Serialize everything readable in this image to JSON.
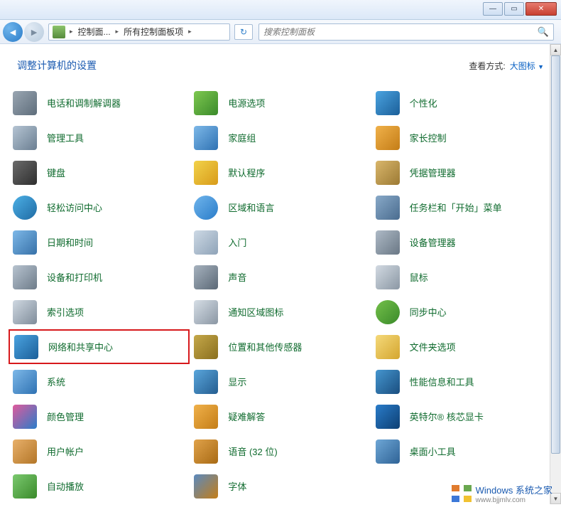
{
  "breadcrumb": {
    "seg1": "控制面...",
    "seg2": "所有控制面板项"
  },
  "search": {
    "placeholder": "搜索控制面板"
  },
  "header": {
    "title": "调整计算机的设置",
    "view_label": "查看方式:",
    "view_value": "大图标"
  },
  "items": [
    {
      "label": "电话和调制解调器",
      "icon": "ic-phone"
    },
    {
      "label": "电源选项",
      "icon": "ic-power"
    },
    {
      "label": "个性化",
      "icon": "ic-personalize"
    },
    {
      "label": "管理工具",
      "icon": "ic-admin"
    },
    {
      "label": "家庭组",
      "icon": "ic-home"
    },
    {
      "label": "家长控制",
      "icon": "ic-parental"
    },
    {
      "label": "键盘",
      "icon": "ic-keyboard"
    },
    {
      "label": "默认程序",
      "icon": "ic-default"
    },
    {
      "label": "凭据管理器",
      "icon": "ic-cred"
    },
    {
      "label": "轻松访问中心",
      "icon": "ic-ease"
    },
    {
      "label": "区域和语言",
      "icon": "ic-region"
    },
    {
      "label": "任务栏和「开始」菜单",
      "icon": "ic-taskbar"
    },
    {
      "label": "日期和时间",
      "icon": "ic-date"
    },
    {
      "label": "入门",
      "icon": "ic-start"
    },
    {
      "label": "设备管理器",
      "icon": "ic-device"
    },
    {
      "label": "设备和打印机",
      "icon": "ic-printer"
    },
    {
      "label": "声音",
      "icon": "ic-sound"
    },
    {
      "label": "鼠标",
      "icon": "ic-mouse"
    },
    {
      "label": "索引选项",
      "icon": "ic-index"
    },
    {
      "label": "通知区域图标",
      "icon": "ic-notif"
    },
    {
      "label": "同步中心",
      "icon": "ic-sync"
    },
    {
      "label": "网络和共享中心",
      "icon": "ic-network",
      "highlight": true
    },
    {
      "label": "位置和其他传感器",
      "icon": "ic-location"
    },
    {
      "label": "文件夹选项",
      "icon": "ic-folder"
    },
    {
      "label": "系统",
      "icon": "ic-system"
    },
    {
      "label": "显示",
      "icon": "ic-display"
    },
    {
      "label": "性能信息和工具",
      "icon": "ic-perf"
    },
    {
      "label": "颜色管理",
      "icon": "ic-color"
    },
    {
      "label": "疑难解答",
      "icon": "ic-trouble"
    },
    {
      "label": "英特尔® 核芯显卡",
      "icon": "ic-intel"
    },
    {
      "label": "用户帐户",
      "icon": "ic-user"
    },
    {
      "label": "语音 (32 位)",
      "icon": "ic-speech"
    },
    {
      "label": "桌面小工具",
      "icon": "ic-gadget"
    },
    {
      "label": "自动播放",
      "icon": "ic-autoplay"
    },
    {
      "label": "字体",
      "icon": "ic-font"
    }
  ],
  "watermark": {
    "line1": "Windows 系统之家",
    "line2": "www.bjjmlv.com"
  }
}
